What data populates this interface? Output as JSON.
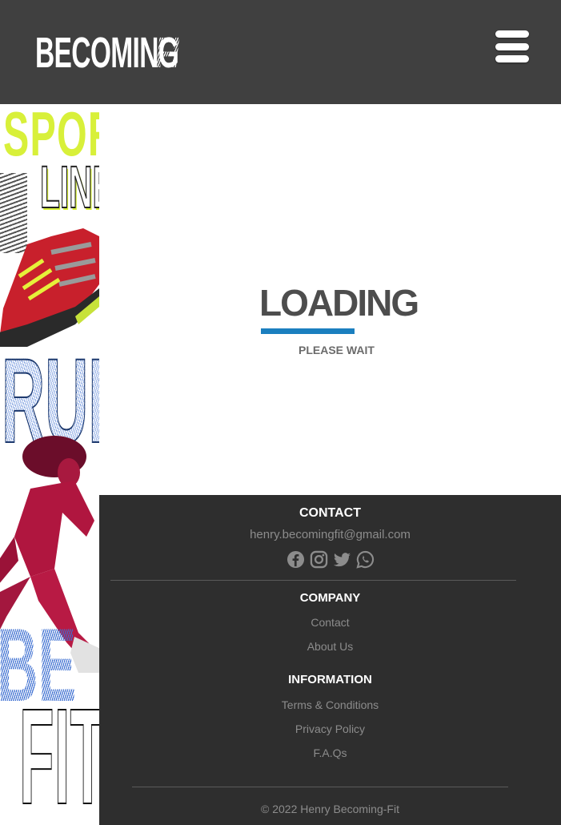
{
  "header": {
    "logo_main": "BECOMING",
    "logo_accent": "FIT",
    "menu_icon": "hamburger-icon",
    "background_color": "#404040"
  },
  "art": {
    "word_sport": "SPORT",
    "word_line": "LINE",
    "word_run": "RUN",
    "word_be": "BE",
    "word_fit": "FIT",
    "accent_lime": "#d8f03a",
    "accent_blue": "#3d6fd1"
  },
  "loading": {
    "title": "LOADING",
    "subtitle": "PLEASE WAIT",
    "bar_color": "#1b7fbf"
  },
  "footer": {
    "contact_heading": "CONTACT",
    "email": "henry.becomingfit@gmail.com",
    "social_icons": [
      "facebook-icon",
      "instagram-icon",
      "twitter-icon",
      "whatsapp-icon"
    ],
    "company_heading": "COMPANY",
    "company_links": [
      "Contact",
      "About Us"
    ],
    "information_heading": "INFORMATION",
    "information_links": [
      "Terms & Conditions",
      "Privacy Policy",
      "F.A.Qs"
    ],
    "copyright": "© 2022 Henry Becoming-Fit",
    "background_color": "#2e2e2e"
  }
}
